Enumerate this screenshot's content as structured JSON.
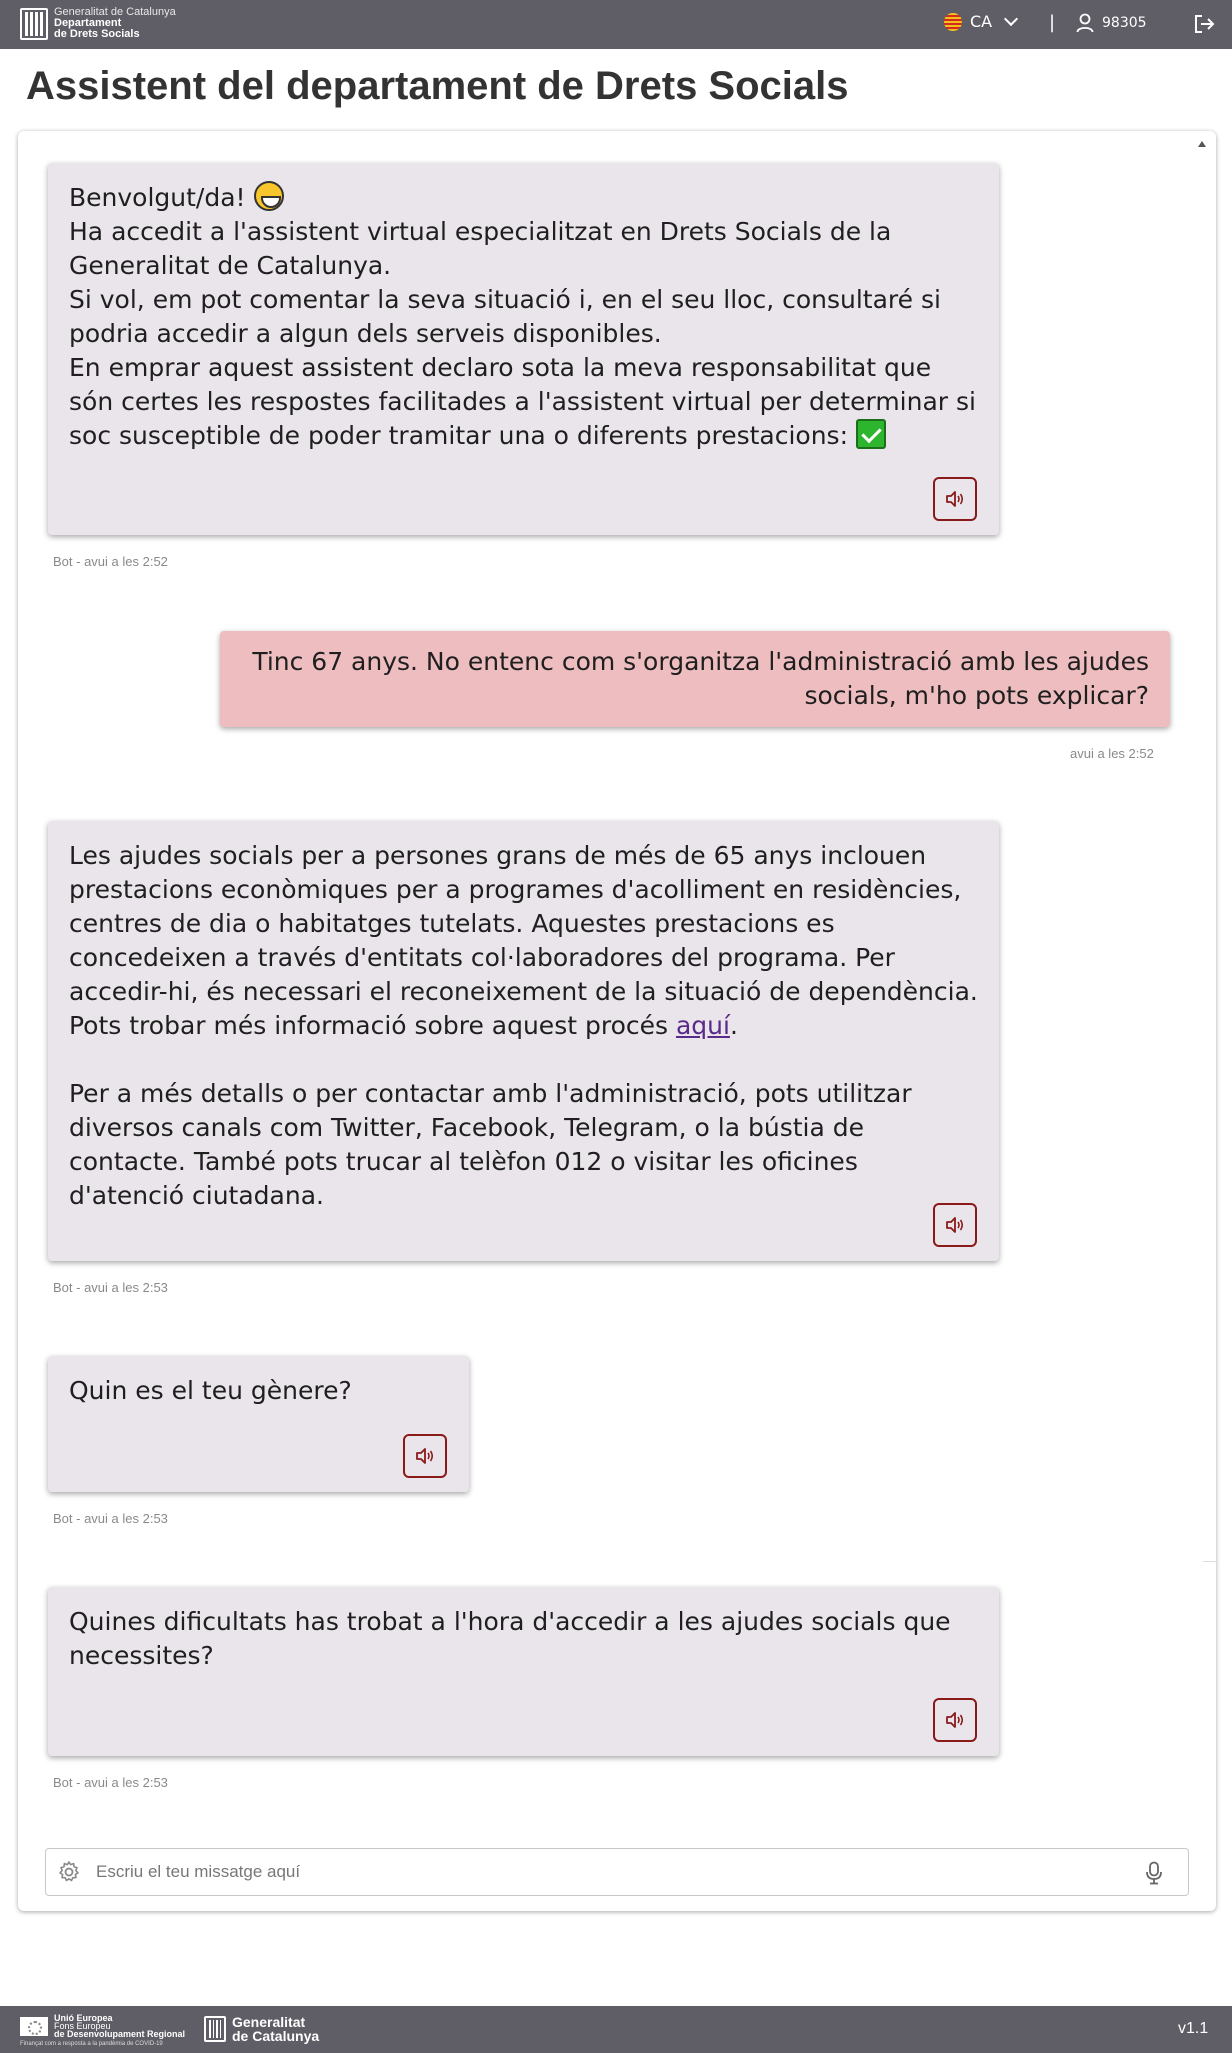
{
  "header": {
    "logo_line1": "Generalitat de Catalunya",
    "logo_line2": "Departament",
    "logo_line3": "de Drets Socials",
    "language": "CA",
    "separator": "|",
    "user_id": "98305"
  },
  "page_title": "Assistent del departament de Drets Socials",
  "messages": [
    {
      "sender": "bot",
      "lines": [
        "Benvolgut/da!",
        "Ha accedit a l'assistent virtual especialitzat en Drets Socials de la Generalitat de Catalunya.",
        "Si vol, em pot comentar la seva situació i, en el seu lloc, consultaré si podria accedir a algun dels serveis disponibles.",
        "En emprar aquest assistent declaro sota la meva responsabilitat que són certes les respostes facilitades a l'assistent virtual per determinar si soc susceptible de poder tramitar una o diferents prestacions:"
      ],
      "timestamp": "Bot - avui a les 2:52"
    },
    {
      "sender": "user",
      "text": "Tinc 67 anys. No entenc com s'organitza l'administració amb les ajudes socials, m'ho pots explicar?",
      "timestamp": "avui a les 2:52"
    },
    {
      "sender": "bot",
      "para1": "Les ajudes socials per a persones grans de més de 65 anys inclouen prestacions econòmiques per a programes d'acolliment en residències, centres de dia o habitatges tutelats. Aquestes prestacions es concedeixen a través d'entitats col·laboradores del programa. Per accedir-hi, és necessari el reconeixement de la situació de dependència. Pots trobar més informació sobre aquest procés",
      "link": "aquí",
      "para1_end": ".",
      "para2": "Per a més detalls o per contactar amb l'administració, pots utilitzar diversos canals com Twitter, Facebook, Telegram, o la bústia de contacte. També pots trucar al telèfon 012 o visitar les oficines d'atenció ciutadana.",
      "timestamp": "Bot - avui a les 2:53"
    },
    {
      "sender": "bot",
      "text": "Quin es el teu gènere?",
      "timestamp": "Bot - avui a les 2:53"
    },
    {
      "sender": "bot",
      "text": "Quines dificultats has trobat a l'hora d'accedir a les ajudes socials que necessites?",
      "timestamp": "Bot - avui a les 2:53"
    }
  ],
  "input": {
    "placeholder": "Escriu el teu missatge aquí",
    "value": ""
  },
  "footer": {
    "eu_line1": "Unió Europea",
    "eu_line2": "Fons Europeu",
    "eu_line3": "de Desenvolupament Regional",
    "eu_subline": "Finançat com a resposta a la pandèmia de COVID-19",
    "gencat_line1": "Generalitat",
    "gencat_line2": "de Catalunya",
    "version": "v1.1"
  },
  "icons": {
    "language_flag": "catalonia-flag-icon",
    "language_dropdown": "chevron-down-icon",
    "user": "user-icon",
    "logout": "logout-icon",
    "speaker": "speaker-icon",
    "settings": "gear-icon",
    "microphone": "microphone-icon",
    "emoji_smile": "grinning-face-emoji",
    "emoji_check": "check-mark-emoji"
  },
  "colors": {
    "topbar": "#5f5e66",
    "bot_bubble": "#e9e5ea",
    "user_bubble": "#eebdbf",
    "speaker_border": "#8a1a1a",
    "link": "#5a2a8a"
  }
}
